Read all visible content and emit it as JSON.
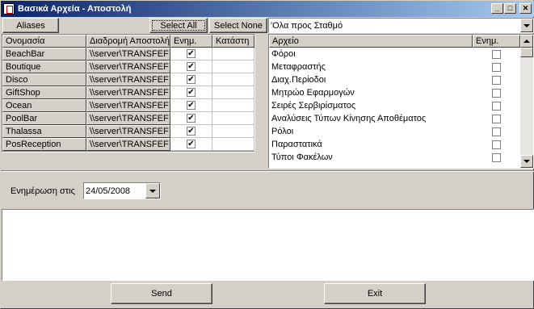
{
  "window": {
    "title": "Βασικά Αρχεία - Αποστολή",
    "min_glyph": "_",
    "max_glyph": "□",
    "close_glyph": "✕",
    "icon": "document-app-icon"
  },
  "toolbar": {
    "aliases_label": "Aliases",
    "select_all_label": "Select All",
    "select_none_label": "Select None",
    "filter_combo_value": "'Ολα προς Σταθμό"
  },
  "left_grid": {
    "headers": [
      "Ονομασία",
      "Διαδρομή Αποστολή",
      "Ενημ.",
      "Κατάστη"
    ],
    "rows": [
      {
        "name": "BeachBar",
        "path": "\\\\server\\TRANSFEF",
        "checked": true,
        "status": ""
      },
      {
        "name": "Boutique",
        "path": "\\\\server\\TRANSFEF",
        "checked": true,
        "status": ""
      },
      {
        "name": "Disco",
        "path": "\\\\server\\TRANSFEF",
        "checked": true,
        "status": ""
      },
      {
        "name": "GiftShop",
        "path": "\\\\server\\TRANSFEF",
        "checked": true,
        "status": ""
      },
      {
        "name": "Ocean",
        "path": "\\\\server\\TRANSFEF",
        "checked": true,
        "status": ""
      },
      {
        "name": "PoolBar",
        "path": "\\\\server\\TRANSFEF",
        "checked": true,
        "status": ""
      },
      {
        "name": "Thalassa",
        "path": "\\\\server\\TRANSFEF",
        "checked": true,
        "status": ""
      },
      {
        "name": "PosReception",
        "path": "\\\\server\\TRANSFEF",
        "checked": true,
        "status": ""
      }
    ]
  },
  "right_list": {
    "headers": [
      "Αρχείο",
      "Ενημ."
    ],
    "rows": [
      {
        "name": "Φόροι",
        "checked": false
      },
      {
        "name": "Μεταφραστής",
        "checked": false
      },
      {
        "name": "Διαχ.Περίοδοι",
        "checked": false
      },
      {
        "name": "Μητρώο Εφαρμογών",
        "checked": false
      },
      {
        "name": "Σειρές Σερβιρίσματος",
        "checked": false
      },
      {
        "name": "Αναλύσεις Τύπων Κίνησης Αποθέματος",
        "checked": false
      },
      {
        "name": "Ρόλοι",
        "checked": false
      },
      {
        "name": "Παραστατικά",
        "checked": false
      },
      {
        "name": "Τύποι Φακέλων",
        "checked": false
      }
    ]
  },
  "update": {
    "label": "Ενημέρωση στις",
    "date_value": "24/05/2008"
  },
  "footer": {
    "send_label": "Send",
    "exit_label": "Exit"
  }
}
